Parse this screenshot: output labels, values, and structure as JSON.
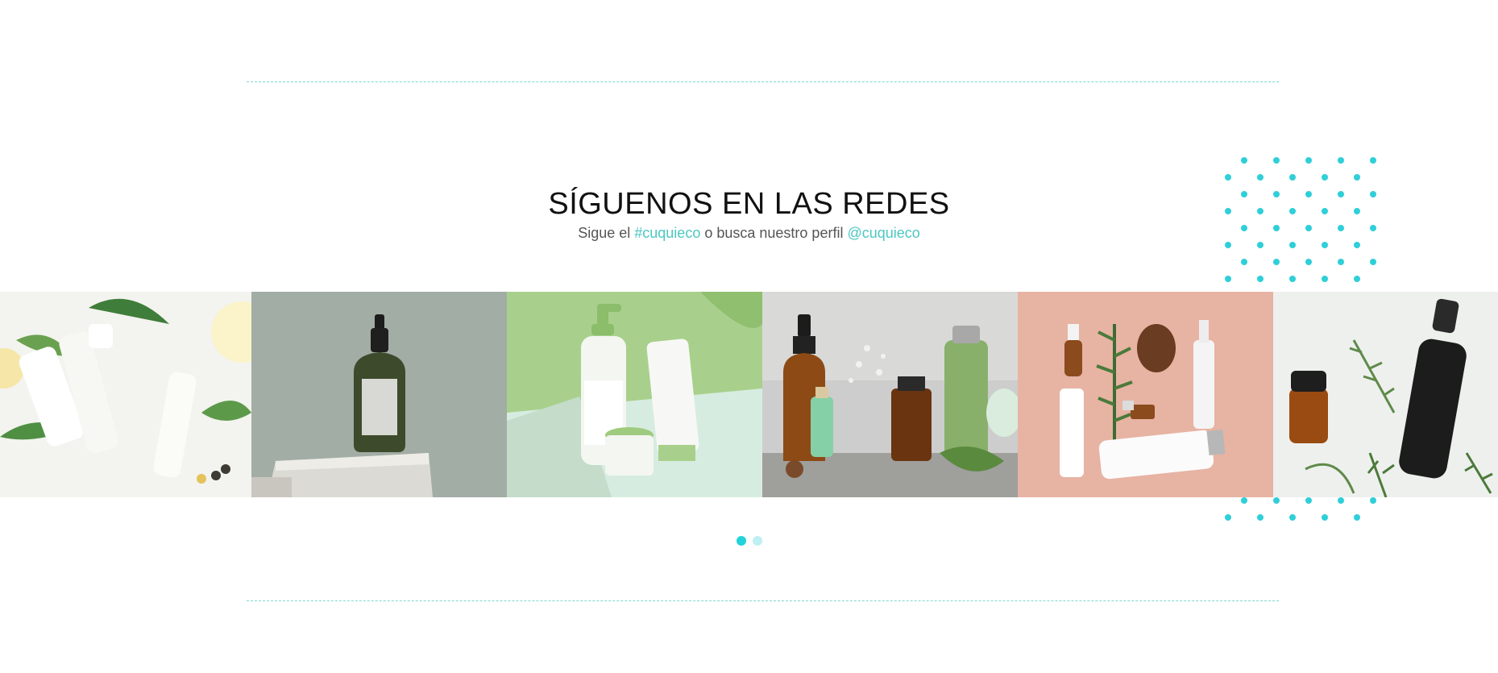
{
  "section": {
    "title": "SÍGUENOS EN LAS REDES",
    "subtitle_prefix": "Sigue el ",
    "hashtag": "#cuquieco",
    "subtitle_middle": " o busca nuestro perfil ",
    "handle": "@cuquieco"
  },
  "colors": {
    "accent": "#4cc7c1",
    "dots": "#2fcfd8",
    "pager_active": "#22d3dc",
    "pager_inactive": "#bfeff2",
    "divider": "#7fd8d2"
  },
  "gallery": {
    "items": [
      {
        "name": "gallery-photo-white-tubes-leaves"
      },
      {
        "name": "gallery-photo-dropper-bottle-stone"
      },
      {
        "name": "gallery-photo-pump-bottle-green"
      },
      {
        "name": "gallery-photo-amber-bottles-flowers"
      },
      {
        "name": "gallery-photo-pink-flatlay"
      },
      {
        "name": "gallery-photo-dark-bottles-herbs"
      }
    ]
  },
  "pager": {
    "active_index": 0,
    "count": 2
  }
}
